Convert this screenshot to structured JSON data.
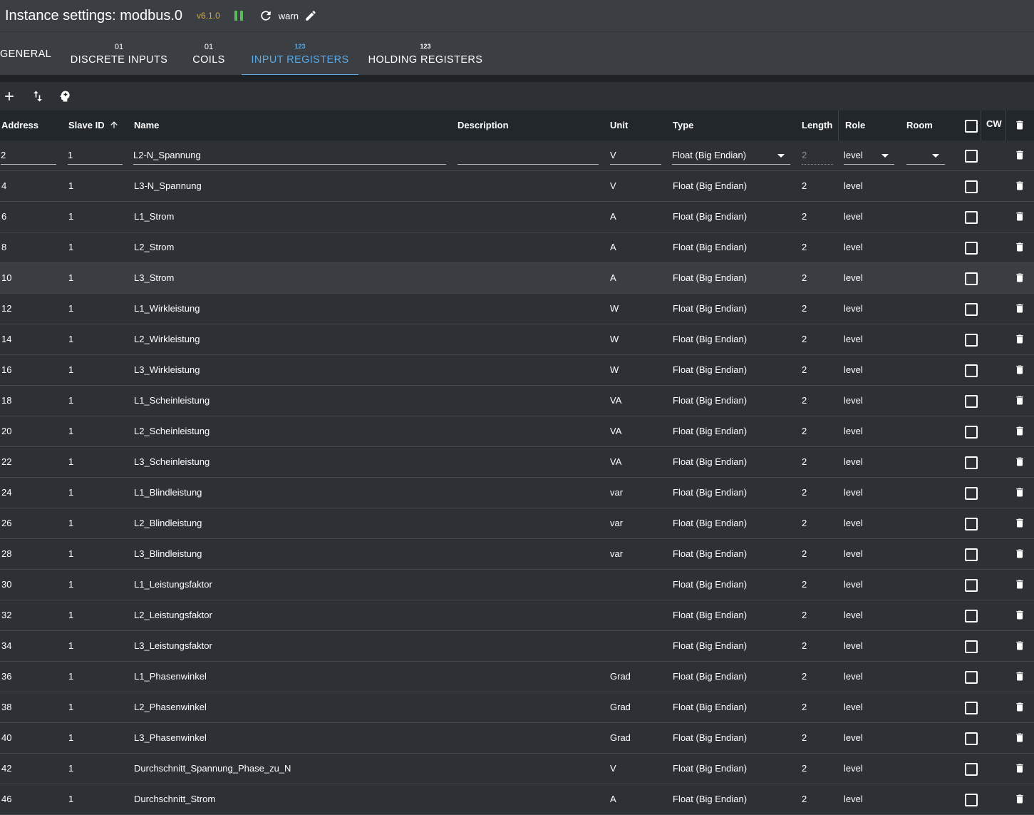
{
  "header": {
    "title": "Instance settings: modbus.0",
    "version": "v6.1.0",
    "log_level": "warn"
  },
  "tabs": [
    {
      "badge": "",
      "label": "GENERAL"
    },
    {
      "badge": "01",
      "label": "DISCRETE INPUTS"
    },
    {
      "badge": "01",
      "label": "COILS"
    },
    {
      "badge": "123",
      "label": "INPUT REGISTERS"
    },
    {
      "badge": "123",
      "label": "HOLDING REGISTERS"
    }
  ],
  "columns": {
    "address": "Address",
    "slave_id": "Slave ID",
    "name": "Name",
    "description": "Description",
    "unit": "Unit",
    "type": "Type",
    "length": "Length",
    "role": "Role",
    "room": "Room",
    "cw": "CW"
  },
  "edit_row": {
    "address": "2",
    "slave_id": "1",
    "name": "L2-N_Spannung",
    "description": "",
    "unit": "V",
    "type": "Float (Big Endian)",
    "length": "2",
    "role": "level",
    "room": ""
  },
  "rows": [
    {
      "address": "4",
      "slave_id": "1",
      "name": "L3-N_Spannung",
      "unit": "V",
      "type": "Float (Big Endian)",
      "length": "2",
      "role": "level"
    },
    {
      "address": "6",
      "slave_id": "1",
      "name": "L1_Strom",
      "unit": "A",
      "type": "Float (Big Endian)",
      "length": "2",
      "role": "level"
    },
    {
      "address": "8",
      "slave_id": "1",
      "name": "L2_Strom",
      "unit": "A",
      "type": "Float (Big Endian)",
      "length": "2",
      "role": "level"
    },
    {
      "address": "10",
      "slave_id": "1",
      "name": "L3_Strom",
      "unit": "A",
      "type": "Float (Big Endian)",
      "length": "2",
      "role": "level"
    },
    {
      "address": "12",
      "slave_id": "1",
      "name": "L1_Wirkleistung",
      "unit": "W",
      "type": "Float (Big Endian)",
      "length": "2",
      "role": "level"
    },
    {
      "address": "14",
      "slave_id": "1",
      "name": "L2_Wirkleistung",
      "unit": "W",
      "type": "Float (Big Endian)",
      "length": "2",
      "role": "level"
    },
    {
      "address": "16",
      "slave_id": "1",
      "name": "L3_Wirkleistung",
      "unit": "W",
      "type": "Float (Big Endian)",
      "length": "2",
      "role": "level"
    },
    {
      "address": "18",
      "slave_id": "1",
      "name": "L1_Scheinleistung",
      "unit": "VA",
      "type": "Float (Big Endian)",
      "length": "2",
      "role": "level"
    },
    {
      "address": "20",
      "slave_id": "1",
      "name": "L2_Scheinleistung",
      "unit": "VA",
      "type": "Float (Big Endian)",
      "length": "2",
      "role": "level"
    },
    {
      "address": "22",
      "slave_id": "1",
      "name": "L3_Scheinleistung",
      "unit": "VA",
      "type": "Float (Big Endian)",
      "length": "2",
      "role": "level"
    },
    {
      "address": "24",
      "slave_id": "1",
      "name": "L1_Blindleistung",
      "unit": "var",
      "type": "Float (Big Endian)",
      "length": "2",
      "role": "level"
    },
    {
      "address": "26",
      "slave_id": "1",
      "name": "L2_Blindleistung",
      "unit": "var",
      "type": "Float (Big Endian)",
      "length": "2",
      "role": "level"
    },
    {
      "address": "28",
      "slave_id": "1",
      "name": "L3_Blindleistung",
      "unit": "var",
      "type": "Float (Big Endian)",
      "length": "2",
      "role": "level"
    },
    {
      "address": "30",
      "slave_id": "1",
      "name": "L1_Leistungsfaktor",
      "unit": "",
      "type": "Float (Big Endian)",
      "length": "2",
      "role": "level"
    },
    {
      "address": "32",
      "slave_id": "1",
      "name": "L2_Leistungsfaktor",
      "unit": "",
      "type": "Float (Big Endian)",
      "length": "2",
      "role": "level"
    },
    {
      "address": "34",
      "slave_id": "1",
      "name": "L3_Leistungsfaktor",
      "unit": "",
      "type": "Float (Big Endian)",
      "length": "2",
      "role": "level"
    },
    {
      "address": "36",
      "slave_id": "1",
      "name": "L1_Phasenwinkel",
      "unit": "Grad",
      "type": "Float (Big Endian)",
      "length": "2",
      "role": "level"
    },
    {
      "address": "38",
      "slave_id": "1",
      "name": "L2_Phasenwinkel",
      "unit": "Grad",
      "type": "Float (Big Endian)",
      "length": "2",
      "role": "level"
    },
    {
      "address": "40",
      "slave_id": "1",
      "name": "L3_Phasenwinkel",
      "unit": "Grad",
      "type": "Float (Big Endian)",
      "length": "2",
      "role": "level"
    },
    {
      "address": "42",
      "slave_id": "1",
      "name": "Durchschnitt_Spannung_Phase_zu_N",
      "unit": "V",
      "type": "Float (Big Endian)",
      "length": "2",
      "role": "level"
    },
    {
      "address": "46",
      "slave_id": "1",
      "name": "Durchschnitt_Strom",
      "unit": "A",
      "type": "Float (Big Endian)",
      "length": "2",
      "role": "level"
    }
  ],
  "hover_row_index": 3,
  "icons": {
    "pause": "pause-icon",
    "reload": "reload-icon",
    "edit": "pencil-icon",
    "add": "plus-icon",
    "import_export": "import-export-icon",
    "ai": "brain-head-icon",
    "sort": "arrow-up-icon",
    "delete": "trash-icon"
  },
  "colors": {
    "accent": "#5aa9e6",
    "version": "#d6a93a",
    "running": "#5cb85c"
  }
}
